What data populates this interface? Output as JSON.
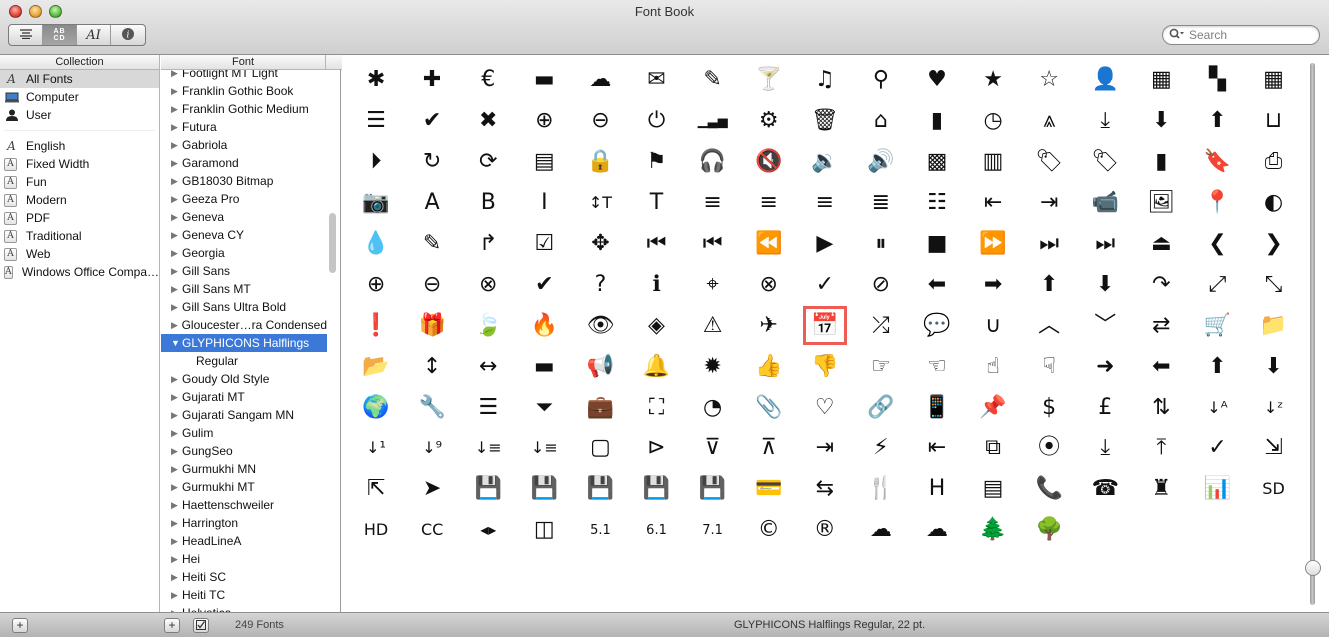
{
  "window": {
    "title": "Font Book"
  },
  "toolbar": {
    "view_buttons": [
      {
        "name": "list-view",
        "icon": "text-lines-icon",
        "glyph": "☰"
      },
      {
        "name": "sample-view",
        "icon": "abcd-grid-icon",
        "glyph": "AB CD",
        "active": true
      },
      {
        "name": "custom-view",
        "icon": "type-cursor-icon",
        "glyph": "AI"
      },
      {
        "name": "info-view",
        "icon": "info-icon",
        "glyph": "ⓘ"
      }
    ],
    "search_placeholder": "Search",
    "search_value": ""
  },
  "collection": {
    "header": "Collection",
    "items": [
      {
        "label": "All Fonts",
        "icon": "A",
        "selected": true
      },
      {
        "label": "Computer",
        "icon": "💻"
      },
      {
        "label": "User",
        "icon": "👤"
      }
    ],
    "groups": [
      {
        "label": "English",
        "icon": "A"
      },
      {
        "label": "Fixed Width",
        "icon": "A"
      },
      {
        "label": "Fun",
        "icon": "A"
      },
      {
        "label": "Modern",
        "icon": "A"
      },
      {
        "label": "PDF",
        "icon": "A"
      },
      {
        "label": "Traditional",
        "icon": "A"
      },
      {
        "label": "Web",
        "icon": "A"
      },
      {
        "label": "Windows Office Compa…",
        "icon": "A"
      }
    ]
  },
  "fonts": {
    "header": "Font",
    "items": [
      {
        "label": "Footlight MT Light"
      },
      {
        "label": "Franklin Gothic Book"
      },
      {
        "label": "Franklin Gothic Medium"
      },
      {
        "label": "Futura"
      },
      {
        "label": "Gabriola"
      },
      {
        "label": "Garamond"
      },
      {
        "label": "GB18030 Bitmap"
      },
      {
        "label": "Geeza Pro"
      },
      {
        "label": "Geneva"
      },
      {
        "label": "Geneva CY"
      },
      {
        "label": "Georgia"
      },
      {
        "label": "Gill Sans"
      },
      {
        "label": "Gill Sans MT"
      },
      {
        "label": "Gill Sans Ultra Bold"
      },
      {
        "label": "Gloucester…ra Condensed"
      },
      {
        "label": "GLYPHICONS Halflings",
        "expanded": true,
        "selected": true
      },
      {
        "label": "Regular",
        "sub": true
      },
      {
        "label": "Goudy Old Style"
      },
      {
        "label": "Gujarati MT"
      },
      {
        "label": "Gujarati Sangam MN"
      },
      {
        "label": "Gulim"
      },
      {
        "label": "GungSeo"
      },
      {
        "label": "Gurmukhi MN"
      },
      {
        "label": "Gurmukhi MT"
      },
      {
        "label": "Haettenschweiler"
      },
      {
        "label": "Harrington"
      },
      {
        "label": "HeadLineA"
      },
      {
        "label": "Hei"
      },
      {
        "label": "Heiti SC"
      },
      {
        "label": "Heiti TC"
      },
      {
        "label": "Helvetica"
      }
    ]
  },
  "glyphs": [
    {
      "n": "asterisk",
      "g": "✱"
    },
    {
      "n": "plus",
      "g": "✚"
    },
    {
      "n": "euro",
      "g": "€"
    },
    {
      "n": "minus",
      "g": "▬"
    },
    {
      "n": "cloud",
      "g": "☁"
    },
    {
      "n": "envelope",
      "g": "✉"
    },
    {
      "n": "pencil",
      "g": "✎"
    },
    {
      "n": "glass",
      "g": "🍸"
    },
    {
      "n": "music",
      "g": "♫"
    },
    {
      "n": "search",
      "g": "⚲"
    },
    {
      "n": "heart",
      "g": "♥"
    },
    {
      "n": "star",
      "g": "★"
    },
    {
      "n": "star-empty",
      "g": "☆"
    },
    {
      "n": "user",
      "g": "👤"
    },
    {
      "n": "film",
      "g": "▦"
    },
    {
      "n": "th-large",
      "g": "▚"
    },
    {
      "n": "th",
      "g": "▦"
    },
    {
      "n": "th-list",
      "g": "☰"
    },
    {
      "n": "ok",
      "g": "✔"
    },
    {
      "n": "remove",
      "g": "✖"
    },
    {
      "n": "zoom-in",
      "g": "⊕"
    },
    {
      "n": "zoom-out",
      "g": "⊖"
    },
    {
      "n": "off",
      "g": "⏻"
    },
    {
      "n": "signal",
      "g": "▁▃▅"
    },
    {
      "n": "cog",
      "g": "⚙"
    },
    {
      "n": "trash",
      "g": "🗑"
    },
    {
      "n": "home",
      "g": "⌂"
    },
    {
      "n": "file",
      "g": "▮"
    },
    {
      "n": "time",
      "g": "◷"
    },
    {
      "n": "road",
      "g": "⩓"
    },
    {
      "n": "download-alt",
      "g": "⤓"
    },
    {
      "n": "download",
      "g": "⬇"
    },
    {
      "n": "upload",
      "g": "⬆"
    },
    {
      "n": "inbox",
      "g": "⊔"
    },
    {
      "n": "play-circle",
      "g": "⏵"
    },
    {
      "n": "repeat",
      "g": "↻"
    },
    {
      "n": "refresh",
      "g": "⟳"
    },
    {
      "n": "list-alt",
      "g": "▤"
    },
    {
      "n": "lock",
      "g": "🔒"
    },
    {
      "n": "flag",
      "g": "⚑"
    },
    {
      "n": "headphones",
      "g": "🎧"
    },
    {
      "n": "volume-off",
      "g": "🔇"
    },
    {
      "n": "volume-down",
      "g": "🔉"
    },
    {
      "n": "volume-up",
      "g": "🔊"
    },
    {
      "n": "qrcode",
      "g": "▩"
    },
    {
      "n": "barcode",
      "g": "▥"
    },
    {
      "n": "tag",
      "g": "🏷"
    },
    {
      "n": "tags",
      "g": "🏷"
    },
    {
      "n": "book",
      "g": "▮"
    },
    {
      "n": "bookmark",
      "g": "🔖"
    },
    {
      "n": "print",
      "g": "⎙"
    },
    {
      "n": "camera",
      "g": "📷"
    },
    {
      "n": "font",
      "g": "A"
    },
    {
      "n": "bold",
      "g": "B"
    },
    {
      "n": "italic",
      "g": "I"
    },
    {
      "n": "text-height",
      "g": "↕T"
    },
    {
      "n": "text-width",
      "g": "T"
    },
    {
      "n": "align-left",
      "g": "≡"
    },
    {
      "n": "align-center",
      "g": "≡"
    },
    {
      "n": "align-right",
      "g": "≡"
    },
    {
      "n": "align-justify",
      "g": "≣"
    },
    {
      "n": "list",
      "g": "☷"
    },
    {
      "n": "indent-left",
      "g": "⇤"
    },
    {
      "n": "indent-right",
      "g": "⇥"
    },
    {
      "n": "facetime-video",
      "g": "📹"
    },
    {
      "n": "picture",
      "g": "🖼"
    },
    {
      "n": "map-marker",
      "g": "📍"
    },
    {
      "n": "adjust",
      "g": "◐"
    },
    {
      "n": "tint",
      "g": "💧"
    },
    {
      "n": "edit",
      "g": "✎"
    },
    {
      "n": "share",
      "g": "↱"
    },
    {
      "n": "check",
      "g": "☑"
    },
    {
      "n": "move",
      "g": "✥"
    },
    {
      "n": "step-backward",
      "g": "⏮"
    },
    {
      "n": "fast-backward",
      "g": "⏮"
    },
    {
      "n": "backward",
      "g": "⏪"
    },
    {
      "n": "play",
      "g": "▶"
    },
    {
      "n": "pause",
      "g": "⏸"
    },
    {
      "n": "stop",
      "g": "■"
    },
    {
      "n": "forward",
      "g": "⏩"
    },
    {
      "n": "fast-forward",
      "g": "⏭"
    },
    {
      "n": "step-forward",
      "g": "⏭"
    },
    {
      "n": "eject",
      "g": "⏏"
    },
    {
      "n": "chevron-left",
      "g": "❮"
    },
    {
      "n": "chevron-right",
      "g": "❯"
    },
    {
      "n": "plus-sign",
      "g": "⊕"
    },
    {
      "n": "minus-sign",
      "g": "⊖"
    },
    {
      "n": "remove-sign",
      "g": "⊗"
    },
    {
      "n": "ok-sign",
      "g": "✔"
    },
    {
      "n": "question-sign",
      "g": "?"
    },
    {
      "n": "info-sign",
      "g": "ℹ"
    },
    {
      "n": "screenshot",
      "g": "⌖"
    },
    {
      "n": "remove-circle",
      "g": "⊗"
    },
    {
      "n": "ok-circle",
      "g": "✓"
    },
    {
      "n": "ban-circle",
      "g": "⊘"
    },
    {
      "n": "arrow-left",
      "g": "⬅"
    },
    {
      "n": "arrow-right",
      "g": "➡"
    },
    {
      "n": "arrow-up",
      "g": "⬆"
    },
    {
      "n": "arrow-down",
      "g": "⬇"
    },
    {
      "n": "share-alt",
      "g": "↷"
    },
    {
      "n": "resize-full",
      "g": "⤢"
    },
    {
      "n": "resize-small",
      "g": "⤡"
    },
    {
      "n": "exclamation-sign",
      "g": "❗"
    },
    {
      "n": "gift",
      "g": "🎁"
    },
    {
      "n": "leaf",
      "g": "🍃"
    },
    {
      "n": "fire",
      "g": "🔥"
    },
    {
      "n": "eye-open",
      "g": "👁"
    },
    {
      "n": "eye-close",
      "g": "◈"
    },
    {
      "n": "warning-sign",
      "g": "⚠"
    },
    {
      "n": "plane",
      "g": "✈"
    },
    {
      "n": "calendar",
      "g": "📅",
      "highlighted": true
    },
    {
      "n": "random",
      "g": "⤮"
    },
    {
      "n": "comment",
      "g": "💬"
    },
    {
      "n": "magnet",
      "g": "∪"
    },
    {
      "n": "chevron-up",
      "g": "︿"
    },
    {
      "n": "chevron-down",
      "g": "﹀"
    },
    {
      "n": "retweet",
      "g": "⇄"
    },
    {
      "n": "shopping-cart",
      "g": "🛒"
    },
    {
      "n": "folder-close",
      "g": "📁"
    },
    {
      "n": "folder-open",
      "g": "📂"
    },
    {
      "n": "resize-vertical",
      "g": "↕"
    },
    {
      "n": "resize-horizontal",
      "g": "↔"
    },
    {
      "n": "hdd",
      "g": "▬"
    },
    {
      "n": "bullhorn",
      "g": "📢"
    },
    {
      "n": "bell",
      "g": "🔔"
    },
    {
      "n": "certificate",
      "g": "✹"
    },
    {
      "n": "thumbs-up",
      "g": "👍"
    },
    {
      "n": "thumbs-down",
      "g": "👎"
    },
    {
      "n": "hand-right",
      "g": "☞"
    },
    {
      "n": "hand-left",
      "g": "☜"
    },
    {
      "n": "hand-up",
      "g": "☝"
    },
    {
      "n": "hand-down",
      "g": "☟"
    },
    {
      "n": "circle-arrow-right",
      "g": "➜"
    },
    {
      "n": "circle-arrow-left",
      "g": "⬅"
    },
    {
      "n": "circle-arrow-up",
      "g": "⬆"
    },
    {
      "n": "circle-arrow-down",
      "g": "⬇"
    },
    {
      "n": "globe",
      "g": "🌍"
    },
    {
      "n": "wrench",
      "g": "🔧"
    },
    {
      "n": "tasks",
      "g": "☰"
    },
    {
      "n": "filter",
      "g": "⏷"
    },
    {
      "n": "briefcase",
      "g": "💼"
    },
    {
      "n": "fullscreen",
      "g": "⛶"
    },
    {
      "n": "dashboard",
      "g": "◔"
    },
    {
      "n": "paperclip",
      "g": "📎"
    },
    {
      "n": "heart-empty",
      "g": "♡"
    },
    {
      "n": "link",
      "g": "🔗"
    },
    {
      "n": "phone",
      "g": "📱"
    },
    {
      "n": "pushpin",
      "g": "📌"
    },
    {
      "n": "usd",
      "g": "$"
    },
    {
      "n": "gbp",
      "g": "£"
    },
    {
      "n": "sort",
      "g": "⇅"
    },
    {
      "n": "sort-by-alphabet",
      "g": "↓ᴬ"
    },
    {
      "n": "sort-by-alphabet-alt",
      "g": "↓ᶻ"
    },
    {
      "n": "sort-by-order",
      "g": "↓¹"
    },
    {
      "n": "sort-by-order-alt",
      "g": "↓⁹"
    },
    {
      "n": "sort-by-attributes",
      "g": "↓≡"
    },
    {
      "n": "sort-by-attributes-alt",
      "g": "↓≡"
    },
    {
      "n": "unchecked",
      "g": "▢"
    },
    {
      "n": "expand",
      "g": "⊳"
    },
    {
      "n": "collapse-down",
      "g": "⊽"
    },
    {
      "n": "collapse-up",
      "g": "⊼"
    },
    {
      "n": "log-in",
      "g": "⇥"
    },
    {
      "n": "flash",
      "g": "⚡"
    },
    {
      "n": "log-out",
      "g": "⇤"
    },
    {
      "n": "new-window",
      "g": "⧉"
    },
    {
      "n": "record",
      "g": "⦿"
    },
    {
      "n": "save",
      "g": "⤓"
    },
    {
      "n": "open",
      "g": "⤒"
    },
    {
      "n": "saved",
      "g": "✓"
    },
    {
      "n": "import",
      "g": "⇲"
    },
    {
      "n": "export",
      "g": "⇱"
    },
    {
      "n": "send",
      "g": "➤"
    },
    {
      "n": "floppy-disk",
      "g": "💾"
    },
    {
      "n": "floppy-saved",
      "g": "💾"
    },
    {
      "n": "floppy-remove",
      "g": "💾"
    },
    {
      "n": "floppy-save",
      "g": "💾"
    },
    {
      "n": "floppy-open",
      "g": "💾"
    },
    {
      "n": "credit-card",
      "g": "💳"
    },
    {
      "n": "transfer",
      "g": "⇆"
    },
    {
      "n": "cutlery",
      "g": "🍴"
    },
    {
      "n": "header",
      "g": "H"
    },
    {
      "n": "compressed",
      "g": "▤"
    },
    {
      "n": "earphone",
      "g": "📞"
    },
    {
      "n": "phone-alt",
      "g": "☎"
    },
    {
      "n": "tower",
      "g": "♜"
    },
    {
      "n": "stats",
      "g": "📊"
    },
    {
      "n": "sd-video",
      "g": "SD"
    },
    {
      "n": "hd-video",
      "g": "HD"
    },
    {
      "n": "subtitles",
      "g": "CC"
    },
    {
      "n": "sound-stereo",
      "g": "◂▸"
    },
    {
      "n": "sound-dolby",
      "g": "◫"
    },
    {
      "n": "sound-5-1",
      "g": "5.1"
    },
    {
      "n": "sound-6-1",
      "g": "6.1"
    },
    {
      "n": "sound-7-1",
      "g": "7.1"
    },
    {
      "n": "copyright-mark",
      "g": "©"
    },
    {
      "n": "registration-mark",
      "g": "®"
    },
    {
      "n": "cloud-download",
      "g": "☁"
    },
    {
      "n": "cloud-upload",
      "g": "☁"
    },
    {
      "n": "tree-conifer",
      "g": "🌲"
    },
    {
      "n": "tree-deciduous",
      "g": "🌳"
    }
  ],
  "status": {
    "font_count": "249 Fonts",
    "preview_info": "GLYPHICONS Halflings Regular, 22 pt."
  },
  "size_slider": {
    "value_pt": 22
  },
  "colors": {
    "selection": "#3b78d8",
    "highlight_box": "#ef5c55"
  }
}
